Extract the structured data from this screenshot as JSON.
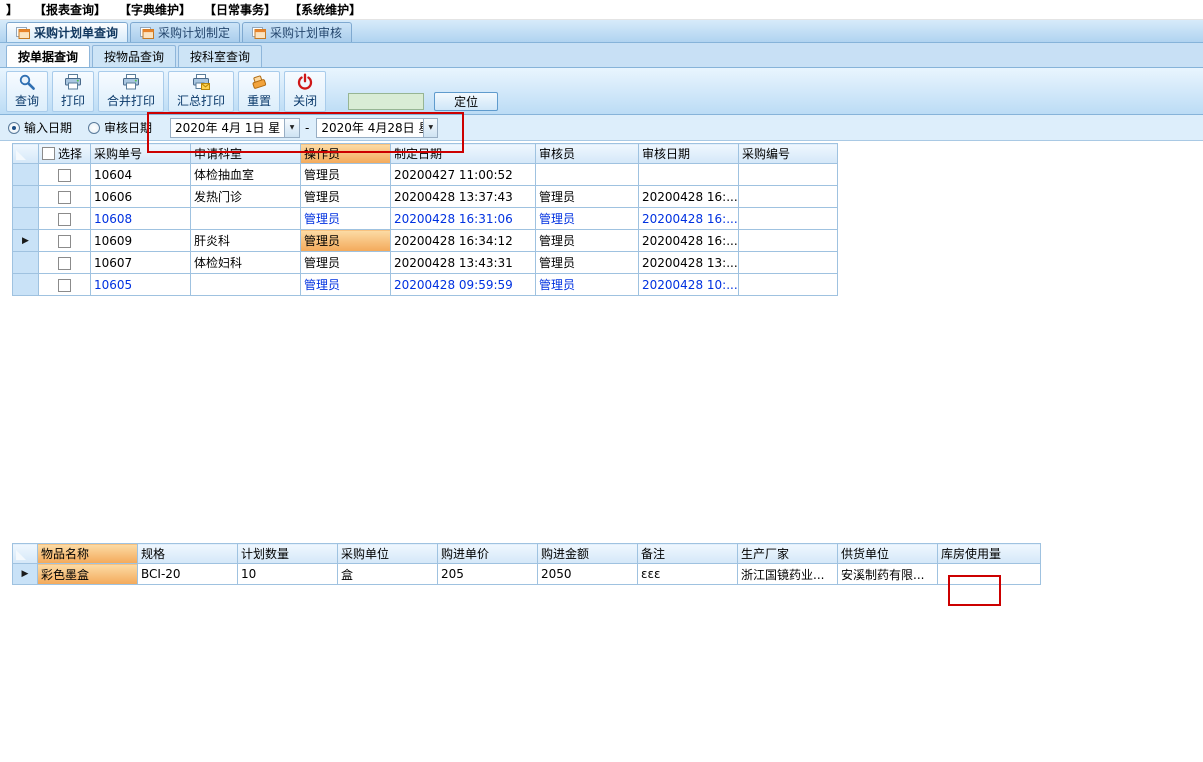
{
  "colors": {
    "annotation_red": "#cc0000",
    "column_highlight_orange": "#f3a95a",
    "blue_row_text": "#0031e0",
    "toolbar_blue": "#bcdcf5",
    "grid_header_blue": "#d4e7f8",
    "quick_input_green": "#d9ecd5"
  },
  "menubar": {
    "prefix": "】",
    "items": [
      "【报表查询】",
      "【字典维护】",
      "【日常事务】",
      "【系统维护】"
    ]
  },
  "tabs": [
    {
      "label": "采购计划单查询",
      "active": true
    },
    {
      "label": "采购计划制定",
      "active": false
    },
    {
      "label": "采购计划审核",
      "active": false
    }
  ],
  "subtabs": [
    {
      "label": "按单据查询",
      "active": true
    },
    {
      "label": "按物品查询",
      "active": false
    },
    {
      "label": "按科室查询",
      "active": false
    }
  ],
  "toolbar": {
    "buttons": [
      {
        "label": "查询",
        "icon": "search-icon"
      },
      {
        "label": "打印",
        "icon": "printer-icon"
      },
      {
        "label": "合并打印",
        "icon": "printer-icon"
      },
      {
        "label": "汇总打印",
        "icon": "printer-sum-icon"
      },
      {
        "label": "重置",
        "icon": "reset-icon"
      },
      {
        "label": "关闭",
        "icon": "power-icon"
      }
    ],
    "locate_input_value": "",
    "locate_button_label": "定位"
  },
  "filters": {
    "input_date_label": "输入日期",
    "audit_date_label": "审核日期",
    "selected_radio": "输入日期",
    "date_from": "2020年 4月 1日 星",
    "range_separator": "-",
    "date_to": "2020年 4月28日 星"
  },
  "orders_table": {
    "select_header": "选择",
    "headers": [
      "采购单号",
      "申请科室",
      "操作员",
      "制定日期",
      "审核员",
      "审核日期",
      "采购编号"
    ],
    "highlight_column": "操作员",
    "rows": [
      {
        "cells": [
          "10604",
          "体检抽血室",
          "管理员",
          "20200427 11:00:52",
          "",
          "",
          ""
        ],
        "blue": false,
        "current": false,
        "operator_cell_highlight": false
      },
      {
        "cells": [
          "10606",
          "发热门诊",
          "管理员",
          "20200428 13:37:43",
          "管理员",
          "20200428 16:...",
          ""
        ],
        "blue": false,
        "current": false,
        "operator_cell_highlight": false
      },
      {
        "cells": [
          "10608",
          "",
          "管理员",
          "20200428 16:31:06",
          "管理员",
          "20200428 16:...",
          ""
        ],
        "blue": true,
        "current": false,
        "operator_cell_highlight": false
      },
      {
        "cells": [
          "10609",
          "肝炎科",
          "管理员",
          "20200428 16:34:12",
          "管理员",
          "20200428 16:...",
          ""
        ],
        "blue": false,
        "current": true,
        "operator_cell_highlight": true
      },
      {
        "cells": [
          "10607",
          "体检妇科",
          "管理员",
          "20200428 13:43:31",
          "管理员",
          "20200428 13:...",
          ""
        ],
        "blue": false,
        "current": false,
        "operator_cell_highlight": false
      },
      {
        "cells": [
          "10605",
          "",
          "管理员",
          "20200428 09:59:59",
          "管理员",
          "20200428 10:...",
          ""
        ],
        "blue": true,
        "current": false,
        "operator_cell_highlight": false
      }
    ]
  },
  "items_table": {
    "headers": [
      "物品名称",
      "规格",
      "计划数量",
      "采购单位",
      "购进单价",
      "购进金额",
      "备注",
      "生产厂家",
      "供货单位",
      "库房使用量"
    ],
    "highlight_column": "物品名称",
    "rows": [
      {
        "cells": [
          "彩色墨盒",
          "BCI-20",
          "10",
          "盒",
          "205",
          "2050",
          "ɛɛɛ",
          "浙江国镜药业...",
          "安溪制药有限...",
          ""
        ],
        "current": true,
        "name_cell_highlight": true
      }
    ]
  }
}
